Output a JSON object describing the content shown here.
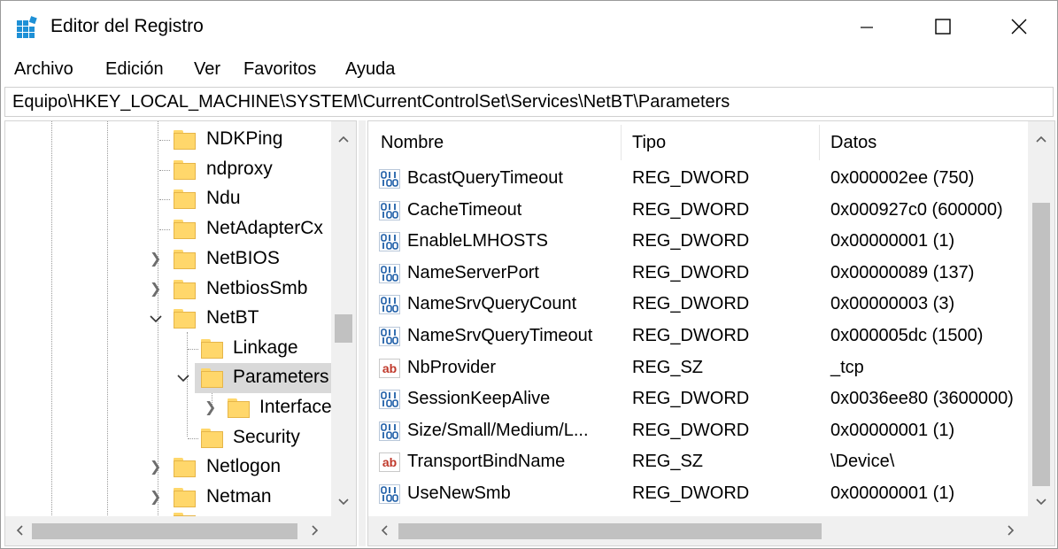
{
  "window": {
    "title": "Editor del Registro"
  },
  "menu": [
    "Archivo",
    "Edición",
    "Ver",
    "Favoritos",
    "Ayuda"
  ],
  "address": "Equipo\\HKEY_LOCAL_MACHINE\\SYSTEM\\CurrentControlSet\\Services\\NetBT\\Parameters",
  "tree": {
    "items": [
      {
        "label": "NDKPing"
      },
      {
        "label": "ndproxy"
      },
      {
        "label": "Ndu"
      },
      {
        "label": "NetAdapterCx"
      },
      {
        "label": "NetBIOS"
      },
      {
        "label": "NetbiosSmb"
      },
      {
        "label": "NetBT"
      },
      {
        "label": "Linkage"
      },
      {
        "label": "Parameters"
      },
      {
        "label": "Interface"
      },
      {
        "label": "Security"
      },
      {
        "label": "Netlogon"
      },
      {
        "label": "Netman"
      }
    ]
  },
  "list": {
    "headers": {
      "name": "Nombre",
      "type": "Tipo",
      "data": "Datos"
    },
    "rows": [
      {
        "name": "BcastQueryTimeout",
        "type": "REG_DWORD",
        "data": "0x000002ee (750)",
        "icon": "binary-value-icon"
      },
      {
        "name": "CacheTimeout",
        "type": "REG_DWORD",
        "data": "0x000927c0 (600000)",
        "icon": "binary-value-icon"
      },
      {
        "name": "EnableLMHOSTS",
        "type": "REG_DWORD",
        "data": "0x00000001 (1)",
        "icon": "binary-value-icon"
      },
      {
        "name": "NameServerPort",
        "type": "REG_DWORD",
        "data": "0x00000089 (137)",
        "icon": "binary-value-icon"
      },
      {
        "name": "NameSrvQueryCount",
        "type": "REG_DWORD",
        "data": "0x00000003 (3)",
        "icon": "binary-value-icon"
      },
      {
        "name": "NameSrvQueryTimeout",
        "type": "REG_DWORD",
        "data": "0x000005dc (1500)",
        "icon": "binary-value-icon"
      },
      {
        "name": "NbProvider",
        "type": "REG_SZ",
        "data": "_tcp",
        "icon": "string-value-icon"
      },
      {
        "name": "SessionKeepAlive",
        "type": "REG_DWORD",
        "data": "0x0036ee80 (3600000)",
        "icon": "binary-value-icon"
      },
      {
        "name": "Size/Small/Medium/L...",
        "type": "REG_DWORD",
        "data": "0x00000001 (1)",
        "icon": "binary-value-icon"
      },
      {
        "name": "TransportBindName",
        "type": "REG_SZ",
        "data": "\\Device\\",
        "icon": "string-value-icon"
      },
      {
        "name": "UseNewSmb",
        "type": "REG_DWORD",
        "data": "0x00000001 (1)",
        "icon": "binary-value-icon"
      }
    ]
  },
  "icons": {
    "string_label": "ab"
  }
}
